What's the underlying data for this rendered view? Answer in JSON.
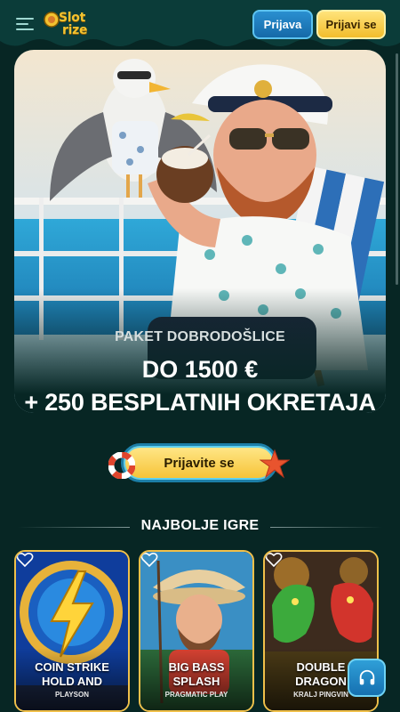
{
  "header": {
    "logo_word_1": "Slot",
    "logo_word_2": "rize",
    "login_label": "Prijava",
    "register_label": "Prijavi se"
  },
  "hero": {
    "label": "PAKET DOBRODOŠLICE",
    "amount": "DO 1500 €",
    "spins": "+ 250 BESPLATNIH OKRETAJA"
  },
  "cta": {
    "label": "Prijavite se"
  },
  "section": {
    "title": "NAJBOLJE IGRE"
  },
  "games": [
    {
      "title_line1": "COIN STRIKE",
      "title_line2": "HOLD AND",
      "provider": "PLAYSON"
    },
    {
      "title_line1": "BIG BASS",
      "title_line2": "SPLASH",
      "provider": "PRAGMATIC PLAY"
    },
    {
      "title_line1": "DOUBLE",
      "title_line2": "DRAGON",
      "provider": "KRALJ PINGVIN"
    }
  ],
  "colors": {
    "background": "#072624",
    "header": "#0b3c39",
    "accent_yellow": "#f6c234",
    "accent_blue": "#1c7fa8",
    "card_border": "#f0c04a"
  },
  "icons": {
    "menu": "hamburger-icon",
    "heart": "heart-icon",
    "support": "headset-icon",
    "lifebuoy": "lifebuoy-icon",
    "starfish": "starfish-icon"
  }
}
